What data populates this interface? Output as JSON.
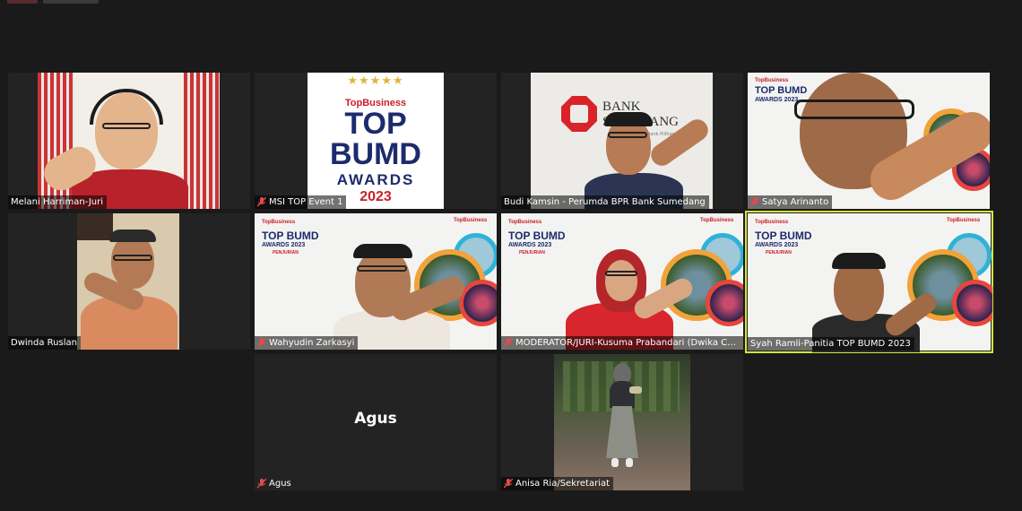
{
  "meeting": {
    "participants": [
      {
        "name": "Melani Harriman-Juri",
        "muted": false
      },
      {
        "name": "MSI TOP Event 1",
        "muted": true
      },
      {
        "name": "Budi Kamsin - Perumda BPR Bank Sumedang",
        "muted": false
      },
      {
        "name": "Satya Arinanto",
        "muted": true
      },
      {
        "name": "Dwinda Ruslan",
        "muted": false
      },
      {
        "name": "Wahyudin Zarkasyi",
        "muted": true
      },
      {
        "name": "MODERATOR/JURI-Kusuma Prabandari (Dwika Consulting)",
        "muted": true
      },
      {
        "name": "Syah Ramli-Panitia TOP BUMD 2023",
        "muted": false
      },
      {
        "name": "Agus",
        "muted": true,
        "video_off_name": "Agus"
      },
      {
        "name": "Anisa Ria/Sekretariat",
        "muted": true
      }
    ],
    "active_speaker_index": 7
  },
  "content": {
    "award_logo": {
      "brand": "TopBusiness",
      "line1": "TOP",
      "line2": "BUMD",
      "line3": "AWARDS",
      "year": "2023"
    },
    "bank_logo": {
      "text": "BANK SUMEDANG",
      "tagline": "Bank Pilihan Rakyat"
    },
    "background_slide": {
      "brand": "TopBusiness",
      "title": "TOP BUMD",
      "subtitle": "AWARDS 2023",
      "tag": "PENJURIAN"
    }
  },
  "colors": {
    "active_border": "#d7e33a",
    "mute_red": "#e34b4b",
    "tile_bg": "#232323",
    "window_bg": "#1a1a1a"
  }
}
